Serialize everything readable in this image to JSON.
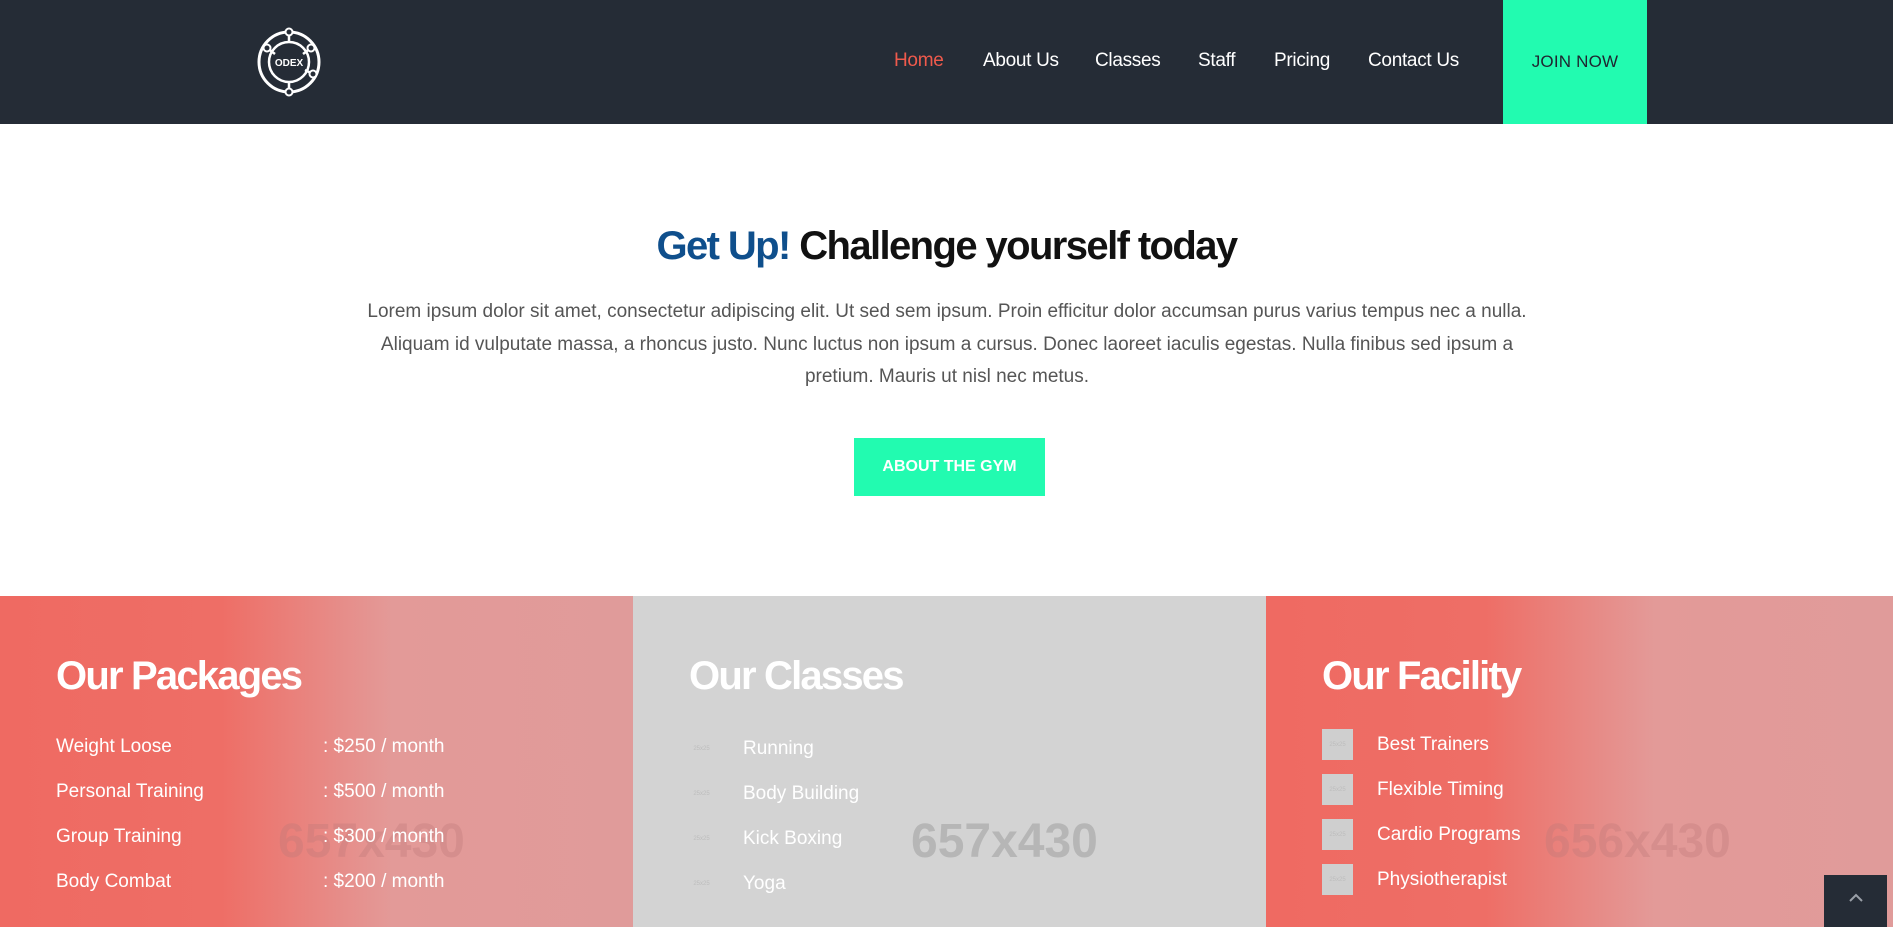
{
  "header": {
    "logo_text": "ODEX",
    "nav": [
      {
        "label": "Home",
        "active": true
      },
      {
        "label": "About Us",
        "active": false
      },
      {
        "label": "Classes",
        "active": false
      },
      {
        "label": "Staff",
        "active": false
      },
      {
        "label": "Pricing",
        "active": false
      },
      {
        "label": "Contact Us",
        "active": false
      }
    ],
    "join_label": "JOIN NOW"
  },
  "hero": {
    "title_accent": "Get Up!",
    "title_rest": " Challenge yourself today",
    "text": "Lorem ipsum dolor sit amet, consectetur adipiscing elit. Ut sed sem ipsum. Proin efficitur dolor accumsan purus varius tempus nec a nulla. Aliquam id vulputate massa, a rhoncus justo. Nunc luctus non ipsum a cursus. Donec laoreet iaculis egestas. Nulla finibus sed ipsum a pretium. Mauris ut nisl nec metus.",
    "button_label": "ABOUT THE GYM"
  },
  "packages": {
    "title": "Our Packages",
    "watermark": "657x430",
    "items": [
      {
        "name": "Weight Loose",
        "price": ": $250 / month"
      },
      {
        "name": "Personal Training",
        "price": ": $500 / month"
      },
      {
        "name": "Group Training",
        "price": ": $300 / month"
      },
      {
        "name": "Body Combat",
        "price": ": $200 / month"
      }
    ]
  },
  "classes": {
    "title": "Our Classes",
    "watermark": "657x430",
    "thumb_text": "25x25",
    "items": [
      "Running",
      "Body Building",
      "Kick Boxing",
      "Yoga"
    ]
  },
  "facility": {
    "title": "Our Facility",
    "watermark": "656x430",
    "thumb_text": "25x25",
    "items": [
      "Best Trainers",
      "Flexible Timing",
      "Cardio Programs",
      "Physiotherapist"
    ]
  },
  "colors": {
    "header_bg": "#252c36",
    "accent_green": "#22fbb0",
    "accent_red": "#ef5a4c",
    "title_blue": "#0f4f8c"
  }
}
